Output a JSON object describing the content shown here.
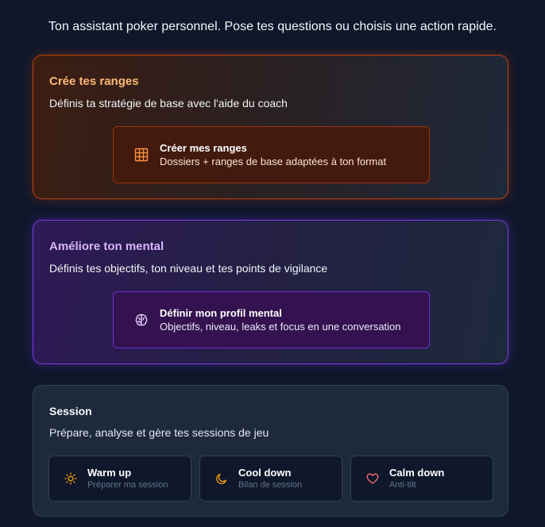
{
  "intro": "Ton assistant poker personnel. Pose tes questions ou choisis une action rapide.",
  "ranges_card": {
    "title": "Crée tes ranges",
    "description": "Définis ta stratégie de base avec l'aide du coach",
    "action": {
      "icon": "grid-icon",
      "title": "Créer mes ranges",
      "subtitle": "Dossiers + ranges de base adaptées à ton format"
    }
  },
  "mental_card": {
    "title": "Améliore ton mental",
    "description": "Définis tes objectifs, ton niveau et tes points de vigilance",
    "action": {
      "icon": "brain-icon",
      "title": "Définir mon profil mental",
      "subtitle": "Objectifs, niveau, leaks et focus en une conversation"
    }
  },
  "session_card": {
    "title": "Session",
    "description": "Prépare, analyse et gère tes sessions de jeu",
    "actions": [
      {
        "icon": "sun-icon",
        "title": "Warm up",
        "subtitle": "Préparer ma session"
      },
      {
        "icon": "moon-icon",
        "title": "Cool down",
        "subtitle": "Bilan de session"
      },
      {
        "icon": "heart-icon",
        "title": "Calm down",
        "subtitle": "Anti-tilt"
      }
    ]
  },
  "colors": {
    "background": "#0f172a",
    "ranges_accent": "#c2410c",
    "ranges_title": "#fdba74",
    "mental_accent": "#7c3aed",
    "mental_title": "#d8b4fe",
    "warm_icon": "#f59e0b",
    "calm_icon": "#f87171"
  }
}
